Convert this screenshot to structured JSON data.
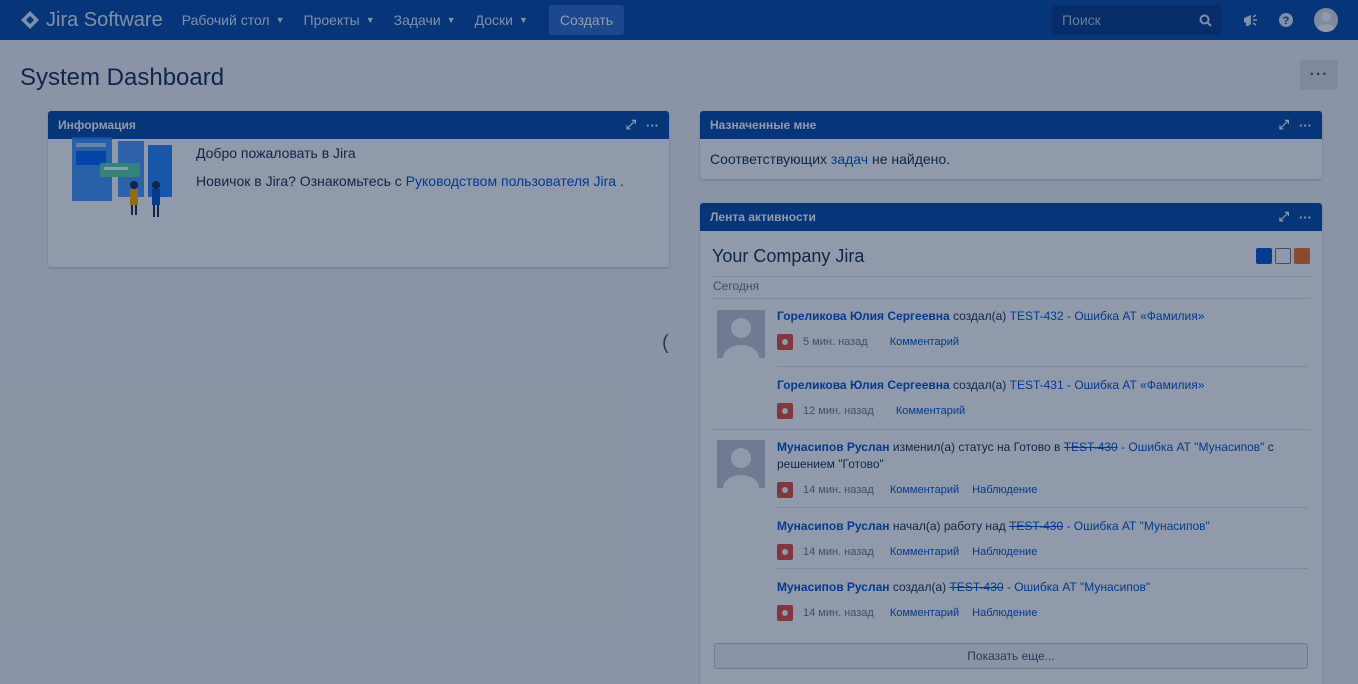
{
  "nav": {
    "logo_text": "Jira Software",
    "items": [
      {
        "label": "Рабочий стол"
      },
      {
        "label": "Проекты"
      },
      {
        "label": "Задачи"
      },
      {
        "label": "Доски"
      }
    ],
    "create_label": "Создать",
    "search_placeholder": "Поиск"
  },
  "page": {
    "title": "System Dashboard",
    "more_label": "···"
  },
  "info_gadget": {
    "title": "Информация",
    "welcome": "Добро пожаловать в Jira",
    "newbie_prefix": "Новичок в Jira? Ознакомьтесь с",
    "guide_link": "Руководством пользователя Jira",
    "newbie_suffix": "."
  },
  "assigned_gadget": {
    "title": "Назначенные мне",
    "prefix": "Соответствующих",
    "link": "задач",
    "suffix": "не найдено."
  },
  "activity_gadget": {
    "title": "Лента активности",
    "stream_title": "Your Company Jira",
    "day_label": "Сегодня",
    "entries": [
      {
        "user": "Гореликова Юлия Сергеевна",
        "action": "создал(а)",
        "issue": "TEST-432 - Ошибка АТ «Фамилия»",
        "time": "5 мин. назад",
        "links": [
          "Комментарий"
        ]
      },
      {
        "user": "Гореликова Юлия Сергеевна",
        "action": "создал(а)",
        "issue": "TEST-431 - Ошибка АТ «Фамилия»",
        "time": "12 мин. назад",
        "links": [
          "Комментарий"
        ]
      },
      {
        "user": "Мунасипов Руслан",
        "action": "изменил(а) статус на Готово в",
        "issue_key": "TEST-430",
        "issue_rest": "- Ошибка АТ \"Мунасипов\"",
        "extra": "с решением \"Готово\"",
        "time": "14 мин. назад",
        "links": [
          "Комментарий",
          "Наблюдение"
        ]
      },
      {
        "user": "Мунасипов Руслан",
        "action": "начал(а) работу над",
        "issue_key": "TEST-430",
        "issue_rest": "- Ошибка АТ \"Мунасипов\"",
        "time": "14 мин. назад",
        "links": [
          "Комментарий",
          "Наблюдение"
        ]
      },
      {
        "user": "Мунасипов Руслан",
        "action": "создал(а)",
        "issue_key": "TEST-430",
        "issue_rest": "- Ошибка АТ \"Мунасипов\"",
        "time": "14 мин. назад",
        "links": [
          "Комментарий",
          "Наблюдение"
        ]
      }
    ],
    "show_more_label": "Показать еще..."
  },
  "icons": {
    "logo": "jira-diamond-icon",
    "search": "search-icon",
    "notifications": "megaphone-icon",
    "help": "help-icon",
    "expand": "expand-icon",
    "more": "more-icon",
    "bug": "bug-icon",
    "rss": "rss-icon"
  },
  "colors": {
    "brand": "#0747a6",
    "link": "#0052cc",
    "bug": "#e5493a",
    "rss": "#f26f21"
  }
}
